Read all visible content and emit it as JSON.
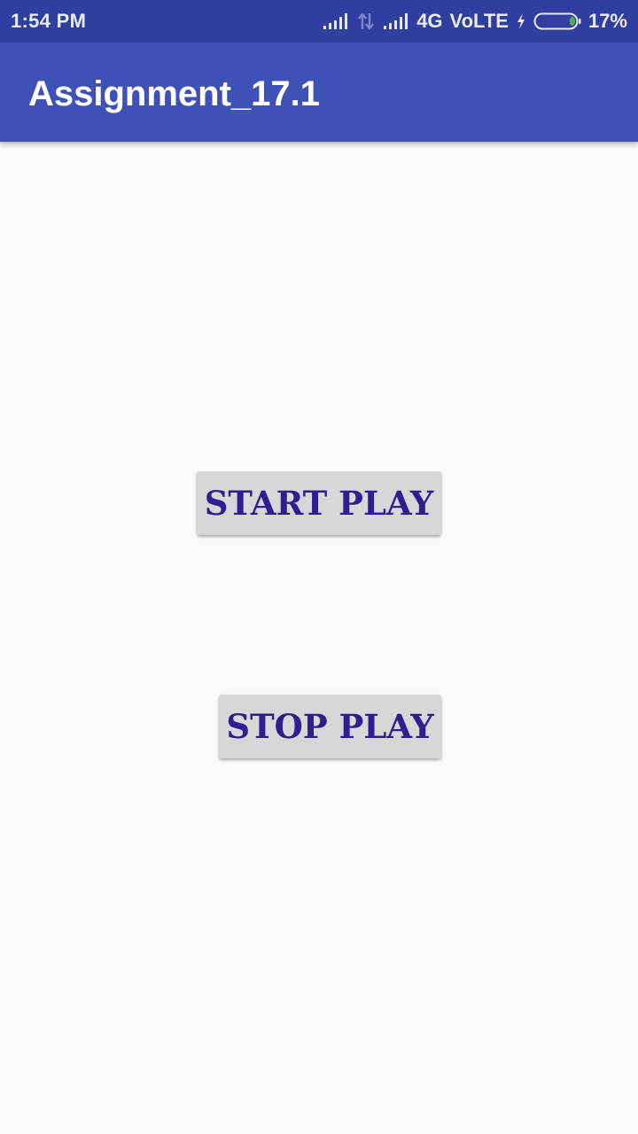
{
  "status_bar": {
    "time": "1:54 PM",
    "network": "4G",
    "volte": "VoLTE",
    "battery": "17%",
    "battery_level": 0.17,
    "icons": [
      "signal-icon",
      "data-arrows-icon",
      "signal-icon",
      "charging-icon",
      "battery-icon"
    ]
  },
  "app_bar": {
    "title": "Assignment_17.1"
  },
  "main": {
    "start_label": "START PLAY",
    "stop_label": "STOP PLAY"
  },
  "colors": {
    "status_bar": "#303f9f",
    "app_bar": "#3f51b5",
    "background": "#fafafa",
    "button_bg": "#d6d7d7",
    "button_text": "#2f1e8f",
    "battery_fill": "#4caf50"
  }
}
